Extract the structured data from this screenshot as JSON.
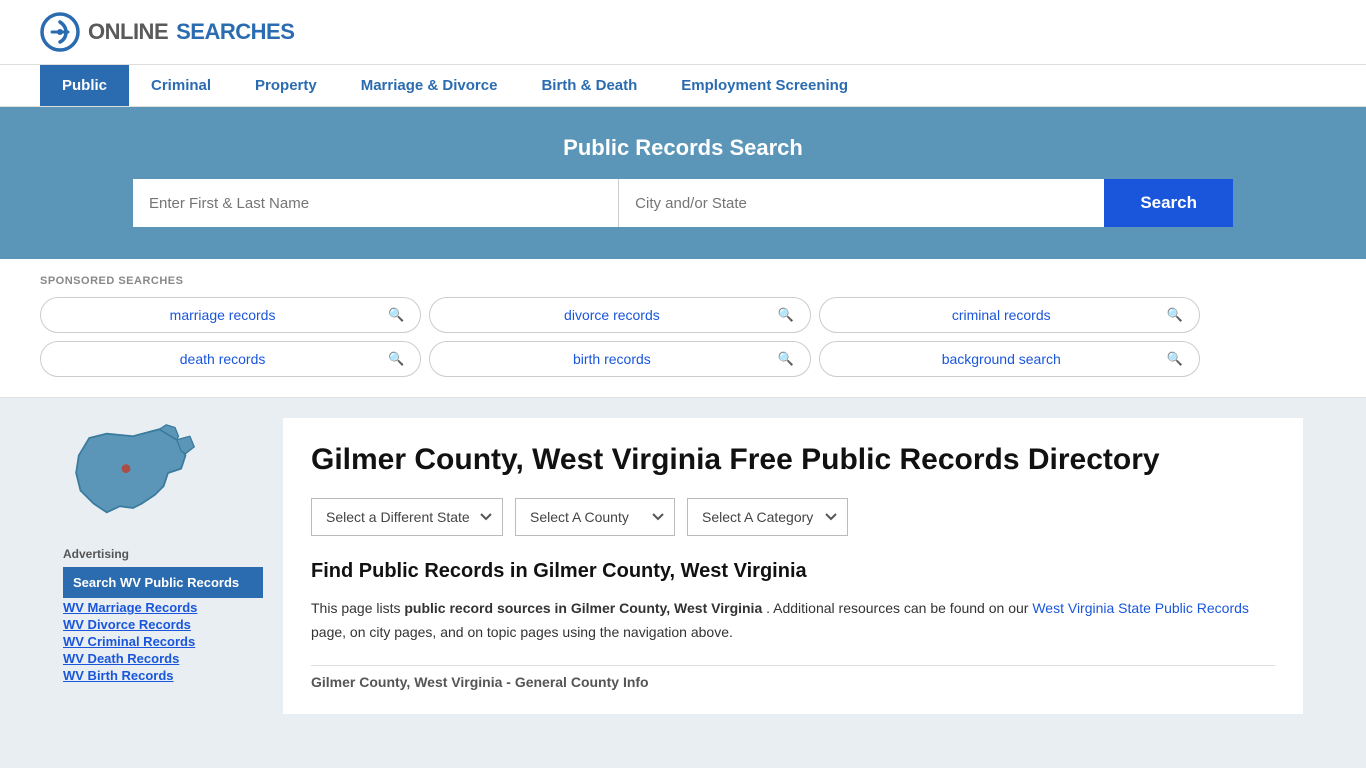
{
  "logo": {
    "text_online": "ONLINE",
    "text_searches": "SEARCHES"
  },
  "nav": {
    "items": [
      {
        "label": "Public",
        "active": true
      },
      {
        "label": "Criminal",
        "active": false
      },
      {
        "label": "Property",
        "active": false
      },
      {
        "label": "Marriage & Divorce",
        "active": false
      },
      {
        "label": "Birth & Death",
        "active": false
      },
      {
        "label": "Employment Screening",
        "active": false
      }
    ]
  },
  "hero": {
    "title": "Public Records Search",
    "name_placeholder": "Enter First & Last Name",
    "location_placeholder": "City and/or State",
    "search_button": "Search"
  },
  "sponsored": {
    "label": "SPONSORED SEARCHES",
    "pills": [
      {
        "label": "marriage records"
      },
      {
        "label": "divorce records"
      },
      {
        "label": "criminal records"
      },
      {
        "label": "death records"
      },
      {
        "label": "birth records"
      },
      {
        "label": "background search"
      }
    ]
  },
  "sidebar": {
    "advertising_label": "Advertising",
    "ad_main_label": "Search WV Public Records",
    "links": [
      "WV Marriage Records",
      "WV Divorce Records",
      "WV Criminal Records",
      "WV Death Records",
      "WV Birth Records"
    ]
  },
  "main": {
    "heading": "Gilmer County, West Virginia Free Public Records Directory",
    "dropdown_state": "Select a Different State",
    "dropdown_county": "Select A County",
    "dropdown_category": "Select A Category",
    "find_heading": "Find Public Records in Gilmer County, West Virginia",
    "description_part1": "This page lists ",
    "description_bold": "public record sources in Gilmer County, West Virginia",
    "description_part2": ". Additional resources can be found on our ",
    "description_link": "West Virginia State Public Records",
    "description_part3": " page, on city pages, and on topic pages using the navigation above.",
    "general_info": "Gilmer County, West Virginia - General County Info"
  }
}
